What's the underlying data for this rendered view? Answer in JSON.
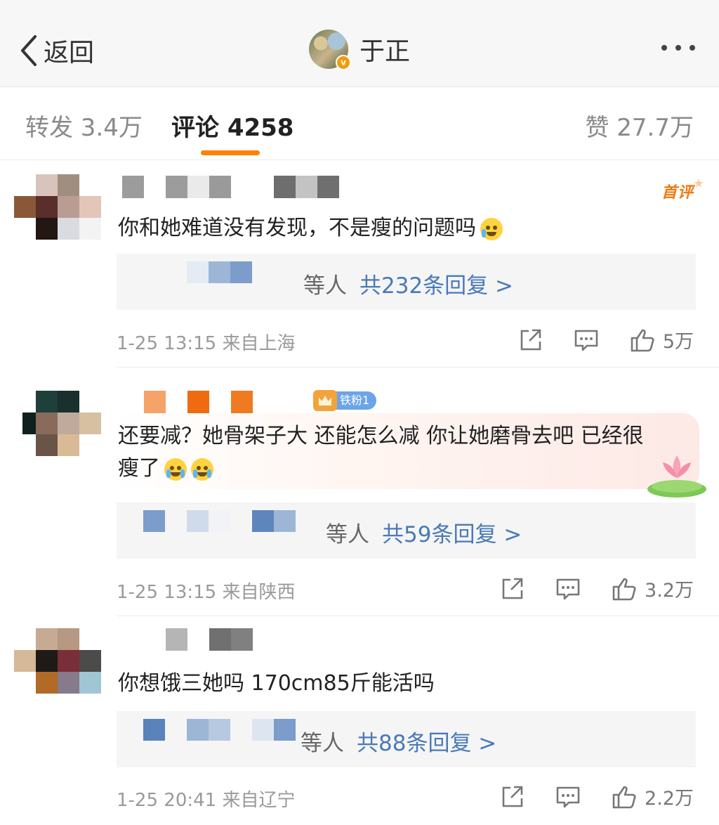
{
  "header": {
    "back_label": "返回",
    "author_name": "于正",
    "verified_badge": "v",
    "icons": {
      "back": "chevron-left-icon",
      "more": "more-dots-icon"
    }
  },
  "tabs": [
    {
      "label": "转发 3.4万",
      "active": false
    },
    {
      "label": "评论 4258",
      "active": true
    },
    {
      "label": "赞 27.7万",
      "active": false
    }
  ],
  "accent_color": "#ff8200",
  "link_color": "#4a79b8",
  "comments": [
    {
      "text": "你和她难道没有发现，不是瘦的问题吗",
      "badge": "首评",
      "replies_prefix": "等人",
      "replies_count": "共232条回复 >",
      "time": "1-25 13:15",
      "location": "来自上海",
      "likes": "5万"
    },
    {
      "text_line1": "还要减？她骨架子大 还能怎么减 你让她磨骨去吧 已经很",
      "text_line2": "瘦了",
      "fan_badge": "铁粉1",
      "replies_prefix": "等人",
      "replies_count": "共59条回复 >",
      "time": "1-25 13:15",
      "location": "来自陕西",
      "likes": "3.2万"
    },
    {
      "text": "你想饿三她吗 170cm85斤能活吗",
      "replies_prefix": "等人",
      "replies_count": "共88条回复 >",
      "time": "1-25 20:41",
      "location": "来自辽宁",
      "likes": "2.2万"
    }
  ]
}
